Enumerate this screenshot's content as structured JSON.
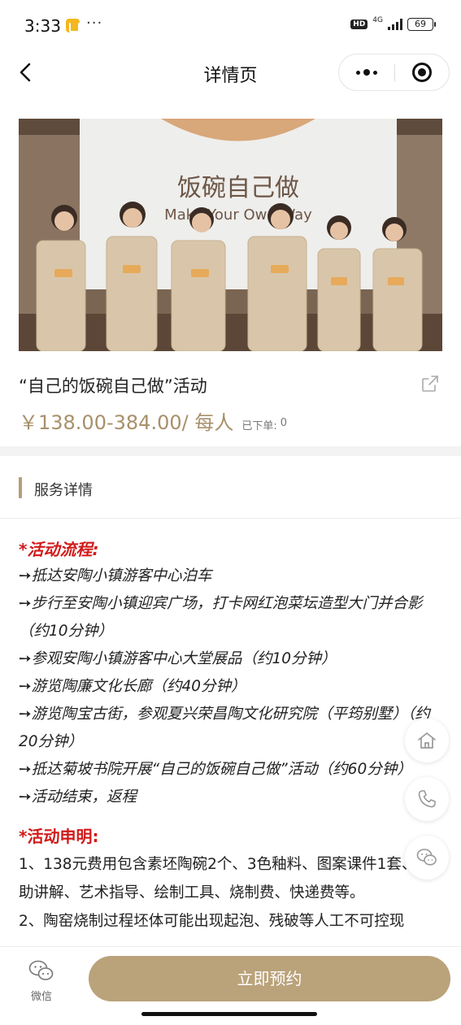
{
  "status_bar": {
    "time": "3:33",
    "dots": "···",
    "hd": "HD",
    "network": "4G",
    "battery": "69"
  },
  "nav": {
    "title": "详情页"
  },
  "hero": {
    "banner_cn": "饭碗自己做",
    "banner_en": "Make Your Own Way"
  },
  "product": {
    "title": "“自己的饭碗自己做”活动",
    "price": "￥138.00-384.00/ 每人",
    "orders_label": "已下单:",
    "orders_count": "0"
  },
  "section": {
    "title": "服务详情"
  },
  "content": {
    "flow_heading": "*活动流程:",
    "flow_items": [
      "➙抵达安陶小镇游客中心泊车",
      "➙步行至安陶小镇迎宾广场，打卡网红泡菜坛造型大门并合影 （约10分钟）",
      "➙参观安陶小镇游客中心大堂展品（约10分钟）",
      "➙游览陶廉文化长廊（约40分钟）",
      "➙游览陶宝古街，参观夏兴荣昌陶文化研究院（平筠别墅）（约20分钟）",
      "➙抵达菊坡书院开展“自己的饭碗自己做”活动（约60分钟）",
      "➙活动结束，返程"
    ],
    "notice_heading": "*活动申明:",
    "notice_items": [
      "1、138元费用包含素坯陶碗2个、3色釉料、图案课件1套、辅助讲解、艺术指导、绘制工具、烧制费、快递费等。",
      "2、陶窑烧制过程坯体可能出现起泡、残破等人工不可控现"
    ]
  },
  "floating": {
    "home_icon": "home-icon",
    "phone_icon": "phone-icon",
    "chat_icon": "wechat-icon"
  },
  "bottom_bar": {
    "wechat_label": "微信",
    "book_label": "立即预约"
  },
  "colors": {
    "accent": "#baa27a",
    "price": "#a8906a",
    "highlight": "#d11a1a"
  }
}
